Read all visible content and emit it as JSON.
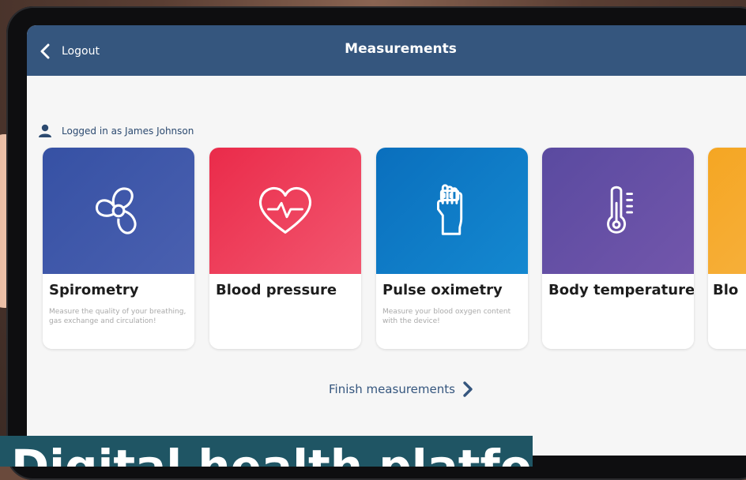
{
  "header": {
    "back_label": "Logout",
    "title": "Measurements"
  },
  "user": {
    "logged_in_text": "Logged in as James Johnson"
  },
  "cards": [
    {
      "name": "Spirometry",
      "description": "Measure the quality of your breathing, gas exchange and circulation!",
      "icon": "fan-icon",
      "color": "#3d56a6"
    },
    {
      "name": "Blood pressure",
      "description": "",
      "icon": "heart-pulse-icon",
      "color": "#ea2f51"
    },
    {
      "name": "Pulse oximetry",
      "description": "Measure your blood oxygen content with the device!",
      "icon": "finger-clip-icon",
      "color": "#0b74c0"
    },
    {
      "name": "Body temperature",
      "description": "",
      "icon": "thermometer-icon",
      "color": "#6a4ea5"
    },
    {
      "name": "Blo",
      "description": "",
      "icon": "",
      "color": "#f5a623"
    }
  ],
  "finish": {
    "label": "Finish measurements"
  },
  "banner": {
    "text": "Digital health platform"
  }
}
